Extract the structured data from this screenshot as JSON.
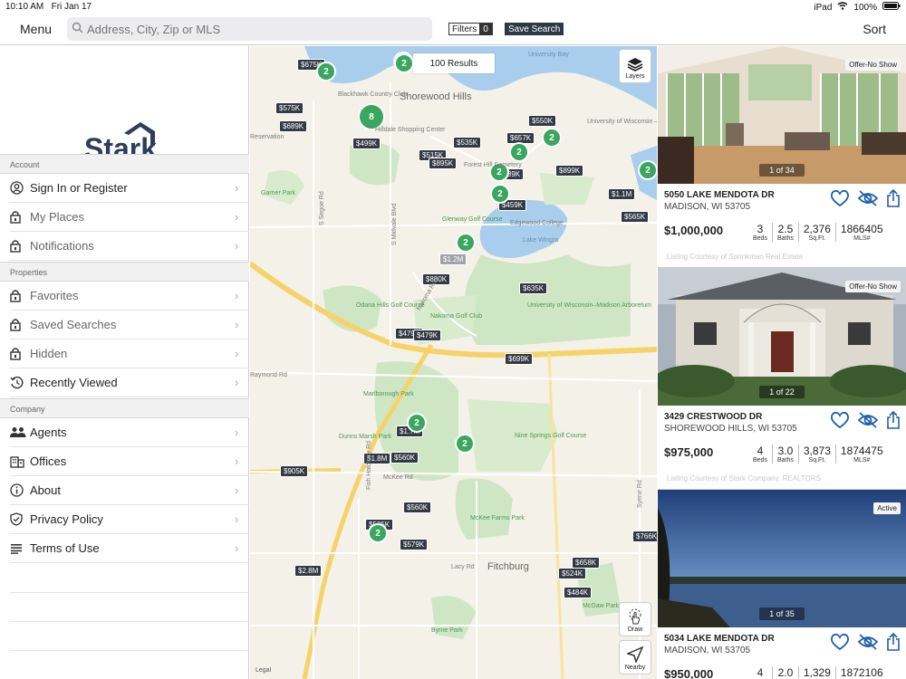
{
  "status": {
    "time": "10:10 AM",
    "date": "Fri Jan 17",
    "device": "iPad",
    "battery": "100%"
  },
  "topbar": {
    "menu_label": "Menu",
    "search_placeholder": "Address, City, Zip or MLS",
    "filters_label": "Filters",
    "filters_count": "0",
    "save_search_label": "Save Search",
    "sort_label": "Sort"
  },
  "sidebar": {
    "logo_text": "Stark",
    "sections": [
      {
        "title": "Account",
        "items": [
          {
            "label": "Sign In or Register",
            "icon": "user-circle-icon"
          },
          {
            "label": "My Places",
            "icon": "lock-icon"
          },
          {
            "label": "Notifications",
            "icon": "lock-icon"
          }
        ]
      },
      {
        "title": "Properties",
        "items": [
          {
            "label": "Favorites",
            "icon": "lock-icon"
          },
          {
            "label": "Saved Searches",
            "icon": "lock-icon"
          },
          {
            "label": "Hidden",
            "icon": "lock-icon"
          },
          {
            "label": "Recently Viewed",
            "icon": "history-icon"
          }
        ]
      },
      {
        "title": "Company",
        "items": [
          {
            "label": "Agents",
            "icon": "people-icon"
          },
          {
            "label": "Offices",
            "icon": "building-icon"
          },
          {
            "label": "About",
            "icon": "info-icon"
          },
          {
            "label": "Privacy Policy",
            "icon": "shield-icon"
          },
          {
            "label": "Terms of Use",
            "icon": "list-icon"
          }
        ]
      }
    ]
  },
  "map": {
    "results_label": "100 Results",
    "layers_label": "Layers",
    "draw_label": "Draw",
    "nearby_label": "Nearby",
    "legal_label": "Legal",
    "prices": [
      "$675K",
      "$575K",
      "$689K",
      "$499K",
      "$535K",
      "$550K",
      "$657K",
      "$515K",
      "$895K",
      "$789K",
      "$899K",
      "$459K",
      "$1.1M",
      "$565K",
      "$1.2M",
      "$880K",
      "$635K",
      "$479K",
      "$479K",
      "$699K",
      "$1.7M",
      "$1.8M",
      "$560K",
      "$905K",
      "$560K",
      "$525K",
      "$579K",
      "$2.8M",
      "$766K",
      "$658K",
      "$524K",
      "$484K"
    ],
    "clusters": [
      "2",
      "2",
      "8",
      "2",
      "2",
      "2",
      "2",
      "2",
      "2",
      "2",
      "2",
      "2",
      "2"
    ],
    "labels": [
      "Blackhawk Country Club",
      "Shorewood Hills",
      "Hilldale Shopping Center",
      "University Bay",
      "University of Wisconsin – Madison",
      "Garner Park",
      "Forest Hill Cemetery",
      "Glenway Golf Course",
      "Edgewood College",
      "Lake Wingra",
      "Odana Hills Golf Course",
      "Nakoma Golf Club",
      "University of Wisconsin–Madison Arboretum",
      "Marlborough Park",
      "Dunns Marsh Park",
      "Nine Springs Golf Course",
      "McKee Farms Park",
      "Fitchburg",
      "McGaw Park",
      "Byrne Park",
      "S Segoe Rd",
      "S Midvale Blvd",
      "Nakoma Rd",
      "McKee Rd",
      "Lacy Rd",
      "Raymond Rd",
      "Fish Hatchery Rd",
      "Syene Rd",
      "Reservation"
    ]
  },
  "listings": [
    {
      "badge": "Offer-No Show",
      "counter": "1 of 34",
      "address": "5050 LAKE MENDOTA DR",
      "city": "MADISON, WI 53705",
      "price": "$1,000,000",
      "beds": "3",
      "baths": "2.5",
      "sqft": "2,376",
      "mls": "1866405",
      "courtesy": "Listing Courtesy of Sprinkman Real Estate"
    },
    {
      "badge": "Offer-No Show",
      "counter": "1 of 22",
      "address": "3429 CRESTWOOD DR",
      "city": "SHOREWOOD HILLS, WI 53705",
      "price": "$975,000",
      "beds": "4",
      "baths": "3.0",
      "sqft": "3,873",
      "mls": "1874475",
      "courtesy": "Listing Courtesy of Stark Company, REALTORS"
    },
    {
      "badge": "Active",
      "counter": "1 of 35",
      "address": "5034 LAKE MENDOTA DR",
      "city": "MADISON, WI 53705",
      "price": "$950,000",
      "beds": "4",
      "baths": "2.0",
      "sqft": "1,329",
      "mls": "1872106",
      "courtesy": ""
    }
  ],
  "stat_labels": {
    "beds": "Beds",
    "baths": "Baths",
    "sqft": "Sq.Ft.",
    "mls": "MLS#"
  },
  "colors": {
    "cluster": "#3aa65f",
    "price_tag": "#333a45",
    "logo_navy": "#2b3e5a"
  }
}
